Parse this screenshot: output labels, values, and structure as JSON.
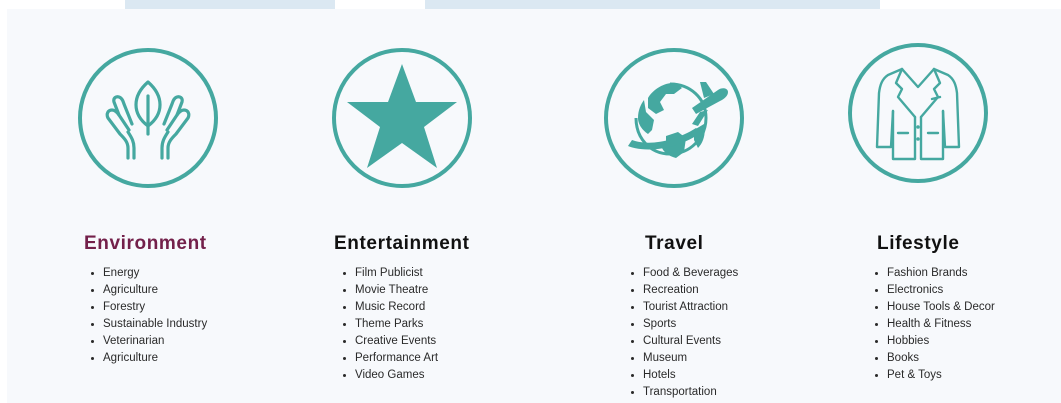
{
  "colors": {
    "teal": "#45a8a0",
    "environment_heading": "#73204a",
    "heading": "#111111"
  },
  "categories": [
    {
      "title": "Environment",
      "icon": "hands-leaf-icon",
      "items": [
        "Energy",
        "Agriculture",
        "Forestry",
        "Sustainable Industry",
        "Veterinarian",
        "Agriculture"
      ]
    },
    {
      "title": "Entertainment",
      "icon": "star-icon",
      "items": [
        "Film Publicist",
        "Movie Theatre",
        "Music Record",
        "Theme Parks",
        "Creative Events",
        "Performance Art",
        "Video Games"
      ]
    },
    {
      "title": "Travel",
      "icon": "globe-airplane-icon",
      "items": [
        "Food & Beverages",
        "Recreation",
        "Tourist Attraction",
        "Sports",
        "Cultural Events",
        "Museum",
        "Hotels",
        "Transportation"
      ]
    },
    {
      "title": "Lifestyle",
      "icon": "blazer-icon",
      "items": [
        "Fashion Brands",
        "Electronics",
        "House Tools & Decor",
        "Health & Fitness",
        "Hobbies",
        "Books",
        "Pet & Toys"
      ]
    }
  ]
}
